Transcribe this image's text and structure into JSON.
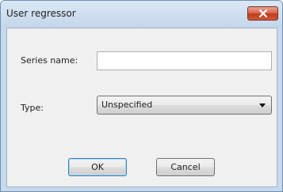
{
  "window": {
    "title": "User regressor"
  },
  "form": {
    "series_label": "Series name:",
    "series_value": "",
    "type_label": "Type:",
    "type_selected": "Unspecified"
  },
  "buttons": {
    "ok_label": "OK",
    "cancel_label": "Cancel"
  },
  "icons": {
    "close": "close-icon",
    "dropdown": "chevron-down-icon"
  },
  "colors": {
    "titlebar": "#c7d9ec",
    "close_button": "#c0391c",
    "client_bg": "#f0f0f0",
    "default_button_border": "#3c7fb1"
  }
}
